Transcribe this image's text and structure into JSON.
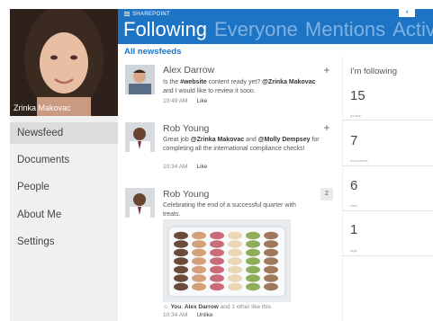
{
  "brand": "SHAREPOINT",
  "profile": {
    "name": "Zrinka Makovac"
  },
  "nav": [
    "Newsfeed",
    "Documents",
    "People",
    "About Me",
    "Settings"
  ],
  "tabs": [
    "Following",
    "Everyone",
    "Mentions",
    "Activ"
  ],
  "top_badge": "4",
  "feed_title": "All newsfeeds",
  "posts": [
    {
      "author": "Alex Darrow",
      "text_parts": [
        "Is the ",
        "#website",
        " content ready yet? ",
        "@Zrinka Makovac",
        " and I would like to review it soon."
      ],
      "time": "10:49 AM",
      "action": "Like",
      "button": "+"
    },
    {
      "author": "Rob Young",
      "text_parts": [
        "Great job ",
        "@Zrinka Makovac",
        " and ",
        "@Molly Dempsey",
        " for completing all the international compliance checks!"
      ],
      "time": "10:34 AM",
      "action": "Like",
      "button": "+"
    },
    {
      "author": "Rob Young",
      "text": "Celebrating the end of a successful quarter with treats.",
      "count": "2",
      "likes_you": "You",
      "likes_sep": ", ",
      "likes_name": "Alex Darrow",
      "likes_rest": " and 1 other like this",
      "time": "10:34 AM",
      "action": "Unlike"
    }
  ],
  "following": {
    "title": "I'm following",
    "stats": [
      {
        "value": "15",
        "label": "people"
      },
      {
        "value": "7",
        "label": "documents"
      },
      {
        "value": "6",
        "label": "sites"
      },
      {
        "value": "1",
        "label": "tags"
      }
    ]
  },
  "colors": {
    "accent": "#1d74c4",
    "tab_inactive": "#7fb2e2"
  }
}
